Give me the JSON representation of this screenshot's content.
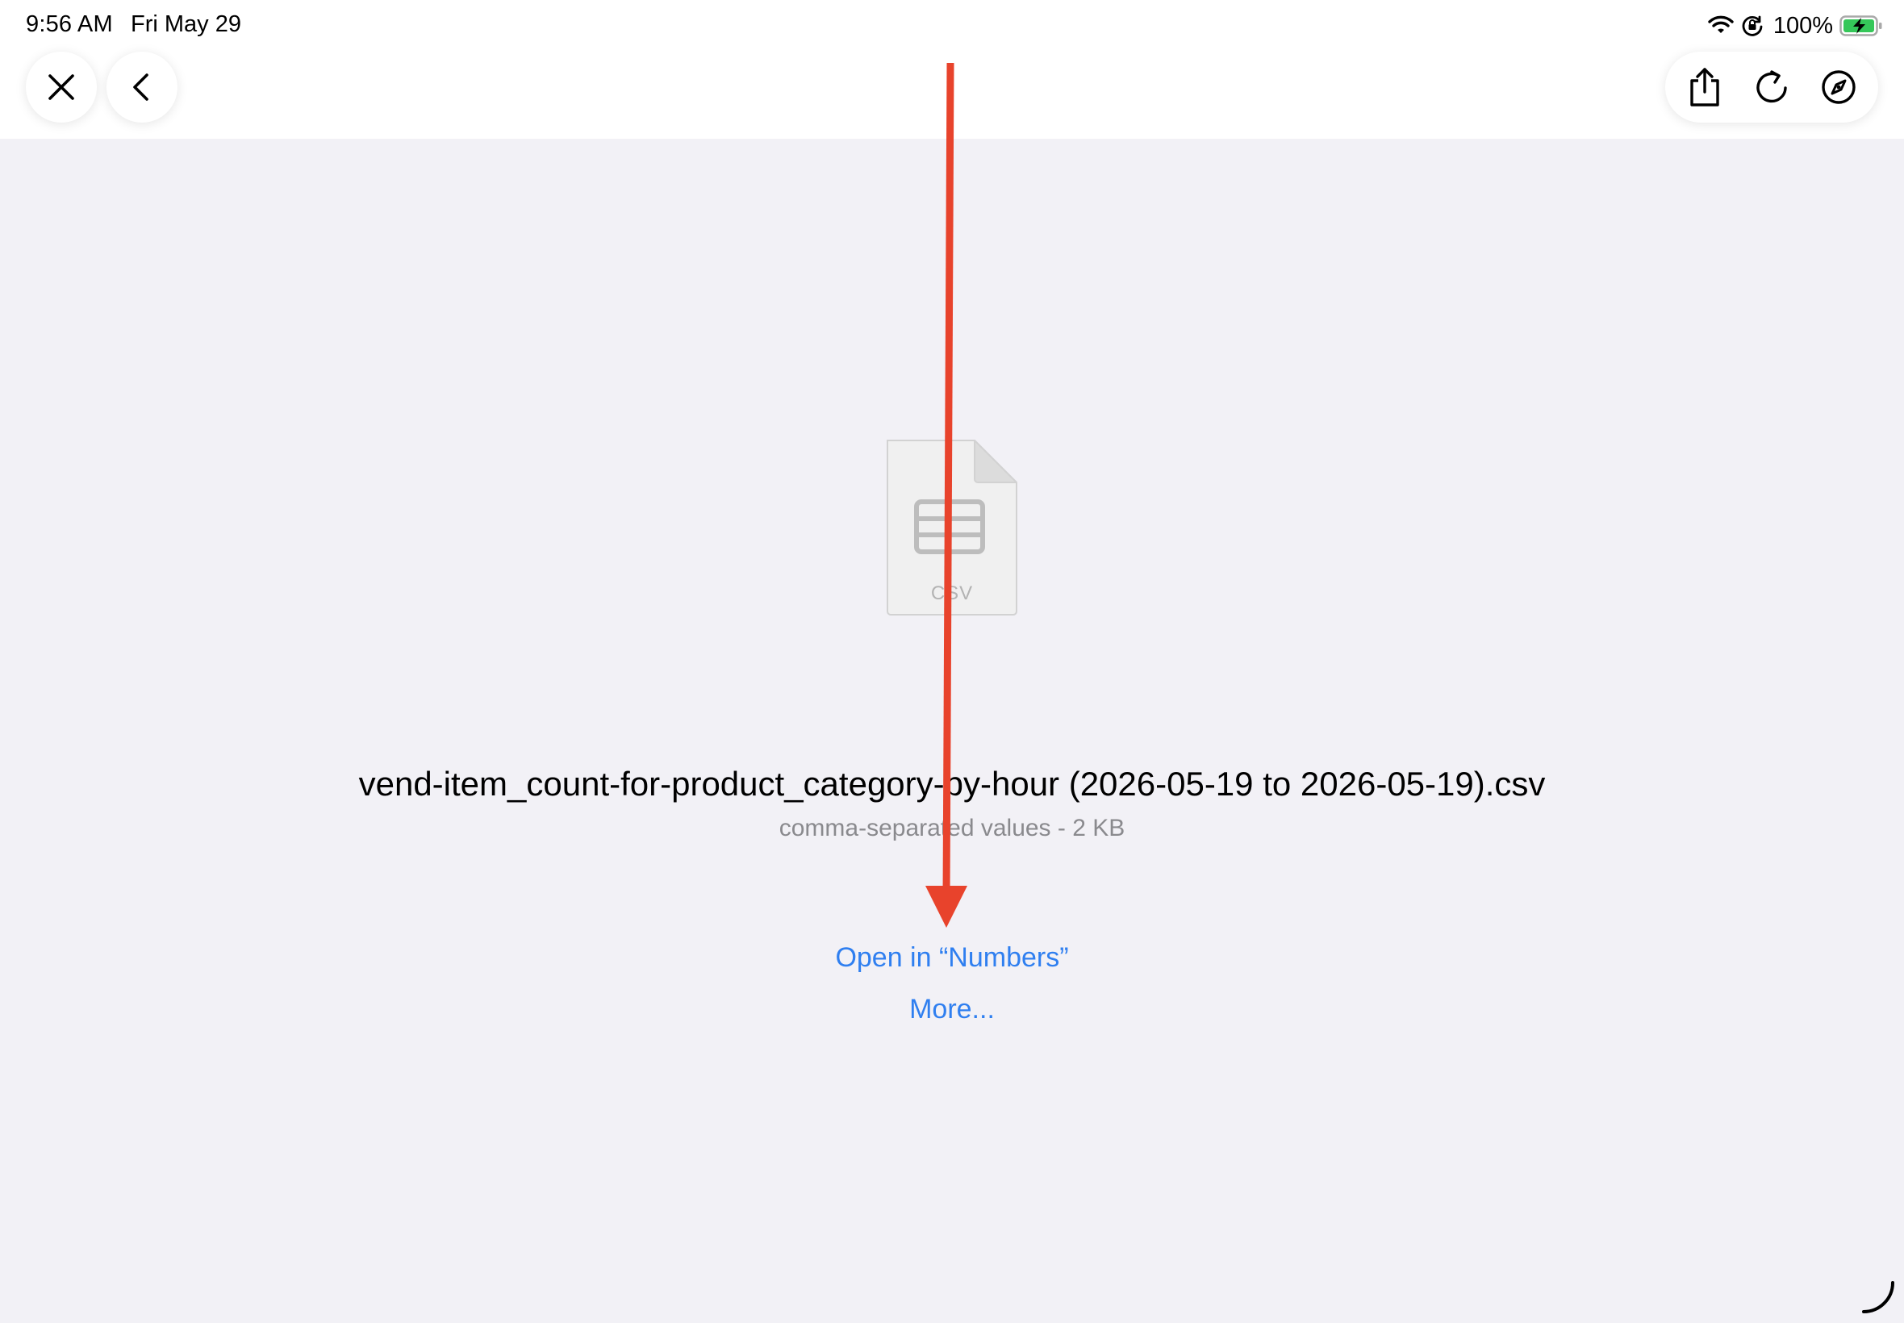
{
  "status_bar": {
    "time": "9:56 AM",
    "date": "Fri May 29",
    "battery_percent": "100%",
    "icons": [
      "wifi-icon",
      "orientation-lock-icon",
      "battery-charging-icon"
    ]
  },
  "toolbar": {
    "left_buttons": [
      "close-icon",
      "back-chevron-icon"
    ],
    "right_buttons": [
      "share-icon",
      "reload-icon",
      "compass-icon"
    ]
  },
  "file": {
    "icon_label": "CSV",
    "name": "vend-item_count-for-product_category-by-hour (2026-05-19 to 2026-05-19).csv",
    "meta": "comma-separated values - 2 KB"
  },
  "actions": {
    "open_in": "Open in “Numbers”",
    "more": "More..."
  },
  "colors": {
    "link": "#2f7ff0",
    "annotation_arrow": "#e8432c",
    "background": "#f2f1f6"
  }
}
